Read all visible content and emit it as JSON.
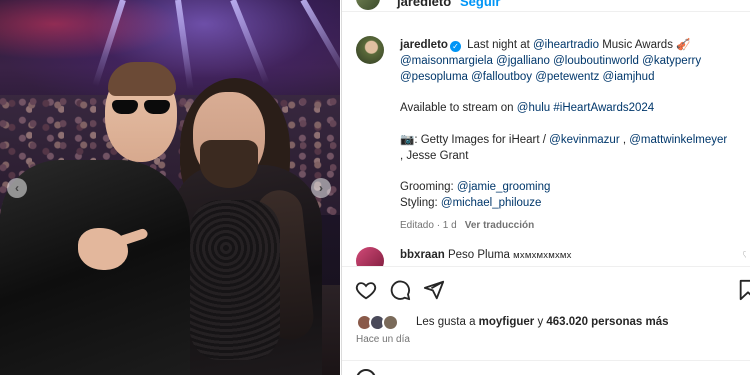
{
  "header": {
    "username": "jaredleto",
    "follow_label": "Seguir"
  },
  "post": {
    "username": "jaredleto",
    "line1_text": "Last night at ",
    "mention_iheartradio": "@iheartradio",
    "line1_tail": " Music Awards 🎻",
    "mentions_line2": "@maisonmargiela @jgalliano @louboutinworld @katyperry",
    "mentions_line3": "@pesopluma @falloutboy @petewentz @iamjhud",
    "stream_text": "Available to stream on ",
    "stream_hulu": "@hulu",
    "stream_hashtag": "#iHeartAwards2024",
    "credit_prefix": "📷: Getty Images for iHeart / ",
    "credit_kevin": "@kevinmazur",
    "credit_sep": " , ",
    "credit_matt": "@mattwinkelmeyer",
    "credit_tail": ", Jesse Grant",
    "grooming_label": "Grooming: ",
    "grooming_handle": "@jamie_grooming",
    "styling_label": "Styling: ",
    "styling_handle": "@michael_philouze",
    "edited": "Editado · 1 d",
    "translate": "Ver traducción"
  },
  "comment": {
    "username": "bbxraan",
    "text": "Peso Pluma",
    "body": "ᴍxᴍxᴍxᴍxᴍx",
    "more": "♡"
  },
  "likes": {
    "prefix": "Les gusta a ",
    "user": "moyfiguer",
    "mid": " y ",
    "count": "463.020 personas más"
  },
  "timestamp": "Hace un día",
  "icons": {
    "like": "heart-icon",
    "comment": "comment-icon",
    "share": "send-icon",
    "save": "bookmark-icon",
    "carousel_prev": "chevron-left-icon",
    "carousel_next": "chevron-right-icon"
  },
  "colors": {
    "link": "#00376b",
    "verified": "#0095f6",
    "muted": "#737373"
  }
}
